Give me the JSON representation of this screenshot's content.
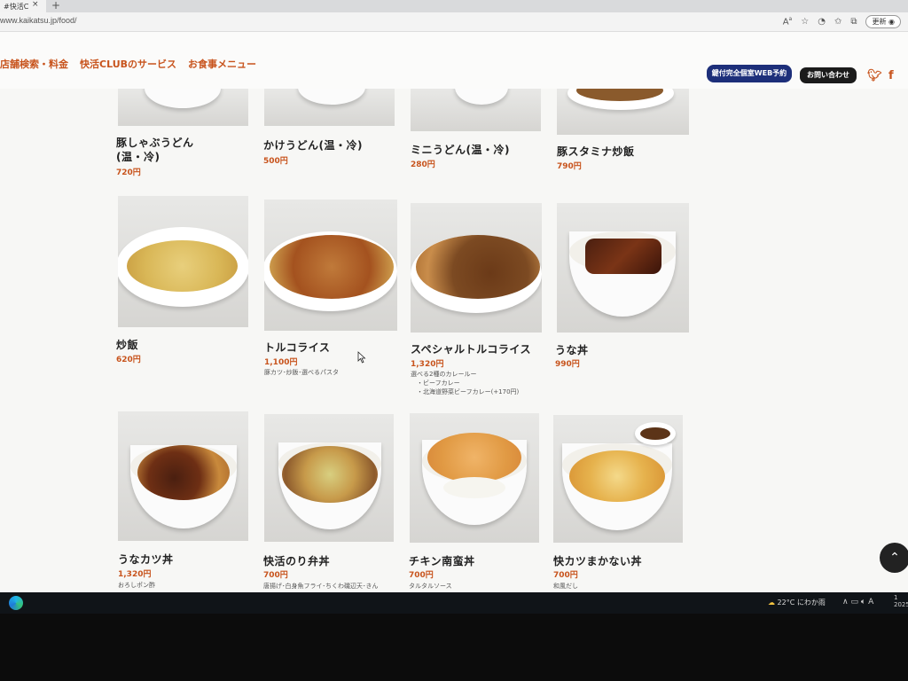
{
  "browser": {
    "tab_title": "#快活C",
    "tab_close": "×",
    "new_tab": "+",
    "url": "www.kaikatsu.jp/food/",
    "update_label": "更新"
  },
  "header": {
    "nav": [
      "店舗検索・料金",
      "快活CLUBのサービス",
      "お食事メニュー"
    ],
    "reserve_button": "鍵付完全個室WEB予約",
    "contact_button": "お問い合わせ",
    "social": [
      "twitter-icon",
      "facebook-icon"
    ]
  },
  "menu": {
    "items": [
      {
        "name": "豚しゃぶうどん",
        "name2": "(温・冷)",
        "price": "720円",
        "desc": ""
      },
      {
        "name": "かけうどん(温・冷)",
        "price": "500円",
        "desc": ""
      },
      {
        "name": "ミニうどん(温・冷)",
        "price": "280円",
        "desc": ""
      },
      {
        "name": "豚スタミナ炒飯",
        "price": "790円",
        "desc": ""
      },
      {
        "name": "炒飯",
        "price": "620円",
        "desc": ""
      },
      {
        "name": "トルコライス",
        "price": "1,100円",
        "desc": "豚カツ･炒飯･選べるパスタ"
      },
      {
        "name": "スペシャルトルコライス",
        "price": "1,320円",
        "desc": "選べる2種のカレールー",
        "desc2": "・ビーフカレー",
        "desc3": "・北海道野菜ビーフカレー(+170円)"
      },
      {
        "name": "うな丼",
        "price": "990円",
        "desc": ""
      },
      {
        "name": "うなカツ丼",
        "price": "1,320円",
        "desc": "おろしポン酢"
      },
      {
        "name": "快活のり弁丼",
        "price": "700円",
        "desc": "唐揚げ･白身魚フライ･ちくわ磯辺天･きん"
      },
      {
        "name": "チキン南蛮丼",
        "price": "700円",
        "desc": "タルタルソース"
      },
      {
        "name": "快カツまかない丼",
        "price": "700円",
        "desc": "和風だし"
      }
    ]
  },
  "scroll_top_icon": "chevron-up-icon",
  "taskbar": {
    "weather": "22°C にわか雨",
    "tray_time": "1",
    "tray_date": "2025",
    "ime": "A"
  },
  "colors": {
    "accent": "#c8541d",
    "reserve_bg": "#1d2f7a",
    "contact_bg": "#1b1b1b"
  }
}
